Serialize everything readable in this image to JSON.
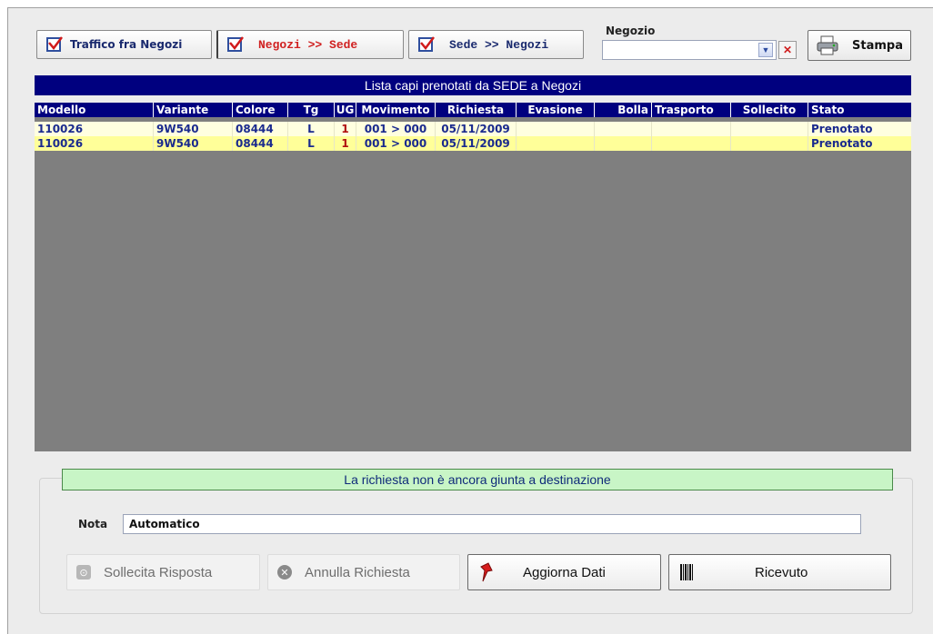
{
  "toolbar": {
    "traffico_label": "Traffico fra Negozi",
    "negozi_sede_label": "Negozi >> Sede",
    "sede_negozi_label": "Sede >> Negozi",
    "negozio_label": "Negozio",
    "negozio_value": "",
    "stampa_label": "Stampa"
  },
  "list": {
    "title": "Lista capi prenotati da SEDE a Negozi",
    "columns": [
      "Modello",
      "Variante",
      "Colore",
      "Tg",
      "UG",
      "Movimento",
      "Richiesta",
      "Evasione",
      "Bolla",
      "Trasporto",
      "Sollecito",
      "Stato"
    ],
    "rows": [
      {
        "modello": "110026",
        "variante": "9W540",
        "colore": "08444",
        "tg": "L",
        "ug": "1",
        "movimento": "001 > 000",
        "richiesta": "05/11/2009",
        "evasione": "",
        "bolla": "",
        "trasporto": "",
        "sollecito": "",
        "stato": "Prenotato"
      },
      {
        "modello": "110026",
        "variante": "9W540",
        "colore": "08444",
        "tg": "L",
        "ug": "1",
        "movimento": "001 > 000",
        "richiesta": "05/11/2009",
        "evasione": "",
        "bolla": "",
        "trasporto": "",
        "sollecito": "",
        "stato": "Prenotato"
      }
    ]
  },
  "detail": {
    "status_message": "La richiesta non è ancora giunta a destinazione",
    "nota_label": "Nota",
    "nota_value": "Automatico"
  },
  "actions": {
    "sollecita_label": "Sollecita Risposta",
    "annulla_label": "Annulla Richiesta",
    "aggiorna_label": "Aggiorna Dati",
    "ricevuto_label": "Ricevuto"
  },
  "colors": {
    "header_navy": "#00007f",
    "row_selected": "#ffff99",
    "row_normal": "#ffffe0",
    "status_green": "#c8f5c6"
  }
}
